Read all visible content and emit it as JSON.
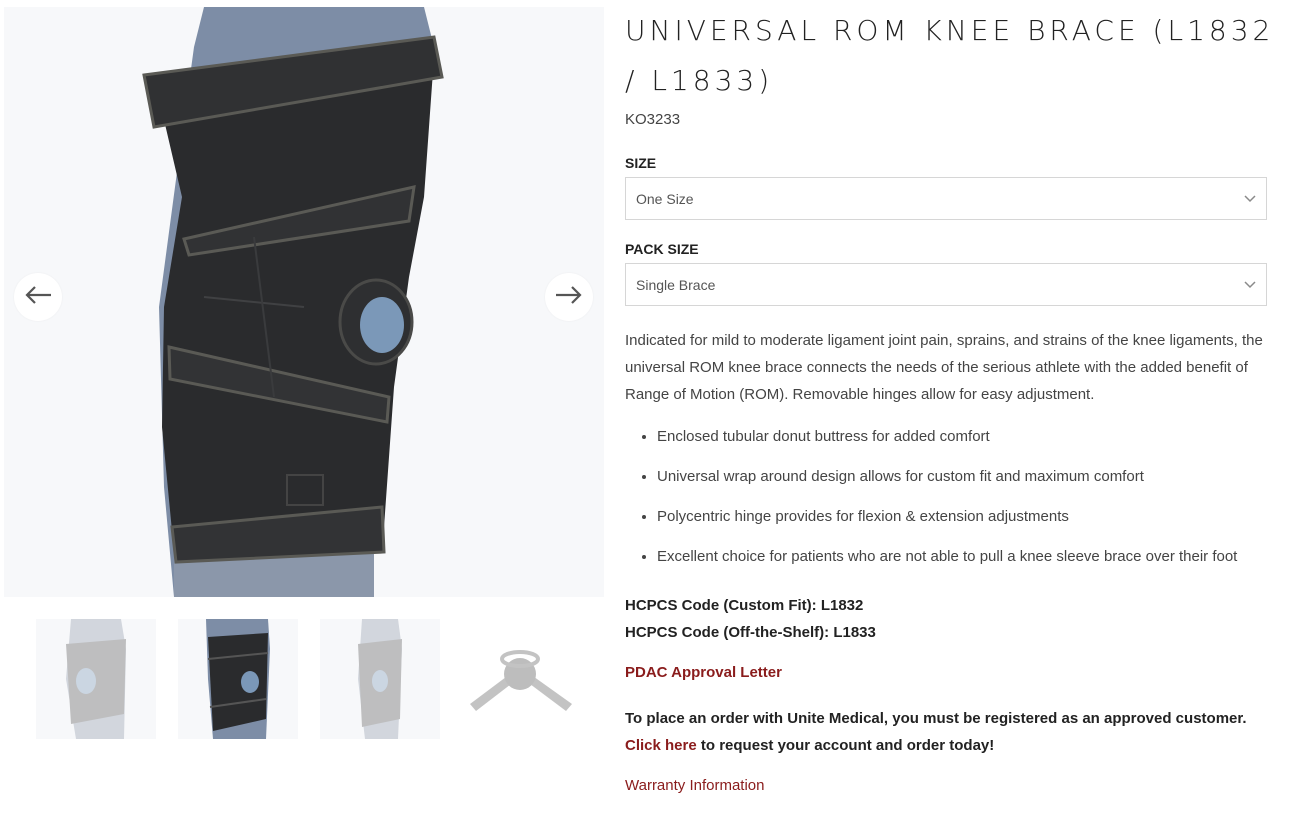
{
  "product": {
    "title": "UNIVERSAL ROM KNEE BRACE (L1832 / L1833)",
    "sku": "KO3233"
  },
  "gallery": {
    "prev_icon": "arrow-left-icon",
    "next_icon": "arrow-right-icon",
    "thumbnails": [
      "knee-brace-front-view",
      "knee-brace-black-view",
      "knee-brace-side-view",
      "hinge-part-view"
    ],
    "active_thumbnail": 2
  },
  "options": {
    "size_label": "SIZE",
    "size_value": "One Size",
    "pack_label": "PACK SIZE",
    "pack_value": "Single Brace",
    "dropdown_icon": "chevron-down-icon"
  },
  "description": "Indicated for mild to moderate ligament joint pain, sprains, and strains of the knee ligaments, the universal ROM knee brace connects the needs of the serious athlete with the added benefit of Range of Motion (ROM). Removable hinges allow for easy adjustment.",
  "features": [
    "Enclosed tubular donut buttress for added comfort",
    "Universal wrap around design allows for custom fit and maximum comfort",
    "Polycentric hinge provides for flexion & extension adjustments",
    "Excellent choice for patients who are not able to pull a knee sleeve brace over their foot"
  ],
  "hcpcs": {
    "custom": "HCPCS Code (Custom Fit): L1832",
    "ots": "HCPCS Code (Off-the-Shelf): L1833"
  },
  "links": {
    "pdac": "PDAC Approval Letter",
    "order_prefix": "To place an order with Unite Medical, you must be registered as an approved customer.",
    "order_link": "Click here",
    "order_suffix": "to request your account and order today!",
    "warranty": "Warranty Information"
  },
  "colors": {
    "accent": "#8a1c1c",
    "brace": "#2a2b2d",
    "background": "#f7f8fa"
  }
}
